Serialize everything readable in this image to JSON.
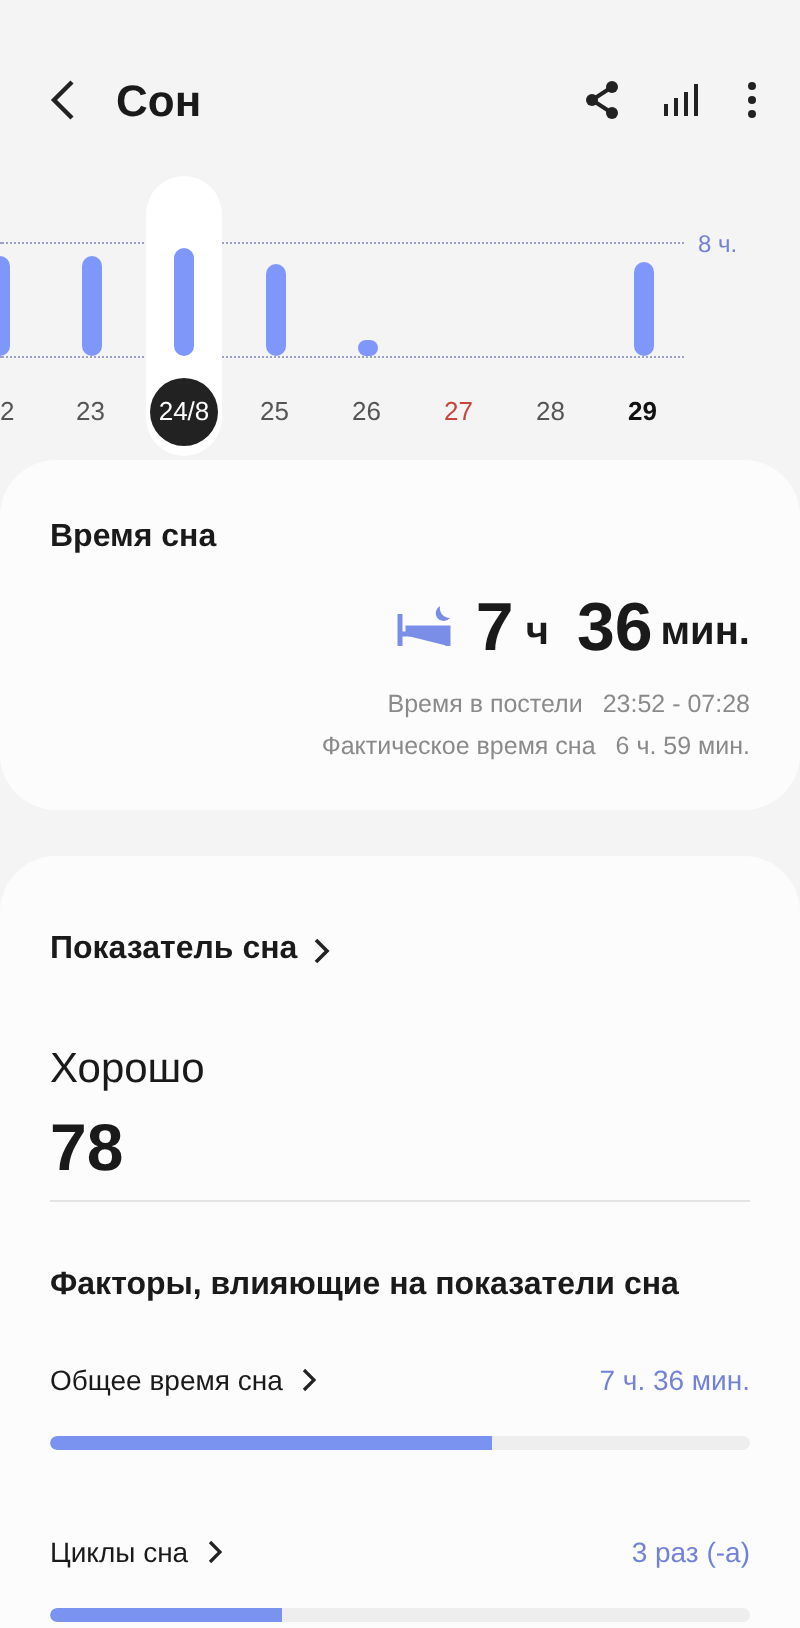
{
  "header": {
    "title": "Сон"
  },
  "chart": {
    "goal_label": "8 ч.",
    "days": [
      {
        "label": "2",
        "selected": false,
        "kind": "normal"
      },
      {
        "label": "23",
        "selected": false,
        "kind": "normal"
      },
      {
        "label": "24/8",
        "selected": true,
        "kind": "normal"
      },
      {
        "label": "25",
        "selected": false,
        "kind": "normal"
      },
      {
        "label": "26",
        "selected": false,
        "kind": "normal"
      },
      {
        "label": "27",
        "selected": false,
        "kind": "holiday"
      },
      {
        "label": "28",
        "selected": false,
        "kind": "normal"
      },
      {
        "label": "29",
        "selected": false,
        "kind": "today"
      }
    ]
  },
  "sleep_time": {
    "title": "Время сна",
    "hours": "7",
    "hours_unit": "ч",
    "minutes": "36",
    "minutes_unit": "мин.",
    "details": [
      {
        "label": "Время в постели",
        "value": "23:52 - 07:28"
      },
      {
        "label": "Фактическое время сна",
        "value": "6 ч. 59 мин."
      }
    ]
  },
  "score": {
    "title": "Показатель сна",
    "rating": "Хорошо",
    "value": "78",
    "factors_title": "Факторы, влияющие на показатели сна",
    "factors": [
      {
        "label": "Общее время сна",
        "value": "7 ч. 36 мин.",
        "level": 0.63
      },
      {
        "label": "Циклы сна",
        "value": "3 раз (-а)",
        "level": 0.33
      }
    ]
  }
}
